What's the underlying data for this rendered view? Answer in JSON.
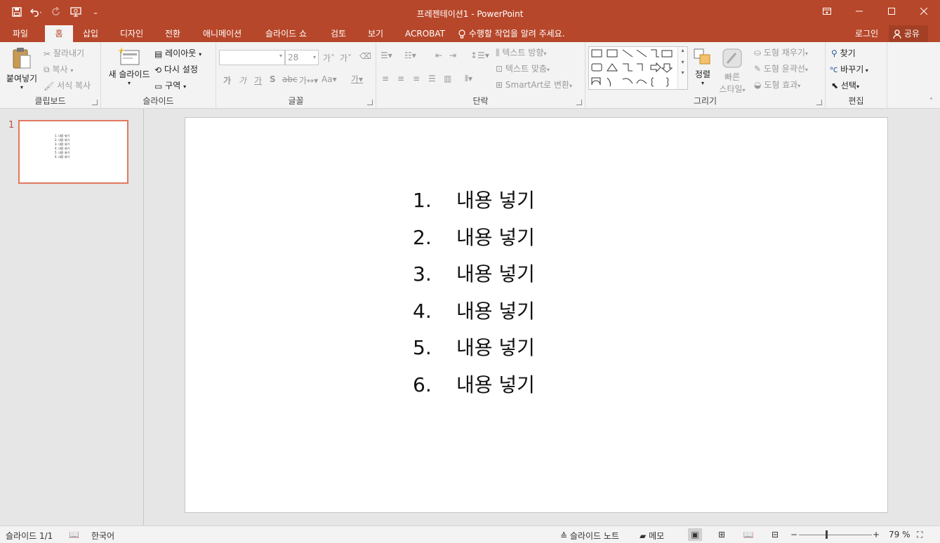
{
  "window": {
    "title": "프레젠테이션1 - PowerPoint",
    "qat_more": "₌"
  },
  "tabs": {
    "items": [
      "파일",
      "홈",
      "삽입",
      "디자인",
      "전환",
      "애니메이션",
      "슬라이드 쇼",
      "검토",
      "보기",
      "ACROBAT"
    ],
    "active": "홈",
    "tell_me": "수행할 작업을 알려 주세요.",
    "signin": "로그인",
    "share": "공유"
  },
  "ribbon": {
    "clipboard": {
      "label": "클립보드",
      "paste": "붙여넣기",
      "cut": "잘라내기",
      "copy": "복사",
      "format_painter": "서식 복사"
    },
    "slides": {
      "label": "슬라이드",
      "new_slide": "새 슬라이드",
      "layout": "레이아웃",
      "reset": "다시 설정",
      "section": "구역"
    },
    "font": {
      "label": "글꼴",
      "font_name": "",
      "font_size": "28"
    },
    "paragraph": {
      "label": "단락",
      "text_direction": "텍스트 방향",
      "align_text": "텍스트 맞춤",
      "smartart": "SmartArt로 변환"
    },
    "drawing": {
      "label": "그리기",
      "arrange": "정렬",
      "quick_styles_1": "빠른",
      "quick_styles_2": "스타일",
      "shape_fill": "도형 채우기",
      "shape_outline": "도형 윤곽선",
      "shape_effects": "도형 효과"
    },
    "editing": {
      "label": "편집",
      "find": "찾기",
      "replace": "바꾸기",
      "select": "선택"
    }
  },
  "slide_pane": {
    "slide_number": "1"
  },
  "slide": {
    "items": [
      {
        "num": "1.",
        "text": "내용 넣기"
      },
      {
        "num": "2.",
        "text": "내용 넣기"
      },
      {
        "num": "3.",
        "text": "내용 넣기"
      },
      {
        "num": "4.",
        "text": "내용 넣기"
      },
      {
        "num": "5.",
        "text": "내용 넣기"
      },
      {
        "num": "6.",
        "text": "내용 넣기"
      }
    ]
  },
  "statusbar": {
    "slide_info": "슬라이드 1/1",
    "language": "한국어",
    "notes": "슬라이드 노트",
    "comments": "메모",
    "zoom": "79 %"
  },
  "colors": {
    "accent": "#b7472a",
    "ribbon_bg": "#f3f3f3",
    "workspace_bg": "#e6e6e6",
    "thumb_border": "#e07a5f"
  }
}
